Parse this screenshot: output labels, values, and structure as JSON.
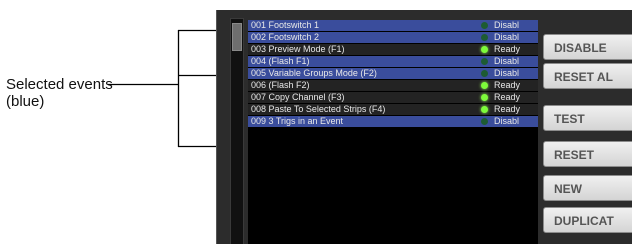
{
  "callout": {
    "line1": "Selected events",
    "line2": "(blue)"
  },
  "events": [
    {
      "label": "001 Footswitch 1",
      "status": "Disabl",
      "selected": true
    },
    {
      "label": "002 Footswitch 2",
      "status": "Disabl",
      "selected": true
    },
    {
      "label": "003 Preview Mode (F1)",
      "status": "Ready",
      "selected": false
    },
    {
      "label": "004     (Flash F1)",
      "status": "Disabl",
      "selected": true
    },
    {
      "label": "005 Variable Groups Mode (F2)",
      "status": "Disabl",
      "selected": true
    },
    {
      "label": "006     (Flash F2)",
      "status": "Ready",
      "selected": false
    },
    {
      "label": "007 Copy Channel (F3)",
      "status": "Ready",
      "selected": false
    },
    {
      "label": "008 Paste To Selected Strips (F4)",
      "status": "Ready",
      "selected": false
    },
    {
      "label": "009 3 Trigs in an Event",
      "status": "Disabl",
      "selected": true
    }
  ],
  "buttons": {
    "disable": "DISABLE",
    "reset_all": "RESET AL",
    "test": "TEST",
    "reset": "RESET",
    "new": "NEW",
    "duplicate": "DUPLICAT"
  },
  "colors": {
    "selected_row": "#3a4d9c",
    "unselected_row": "#232323",
    "ready_led": "#7dfb3a",
    "disabled_led": "#1d5b33"
  }
}
